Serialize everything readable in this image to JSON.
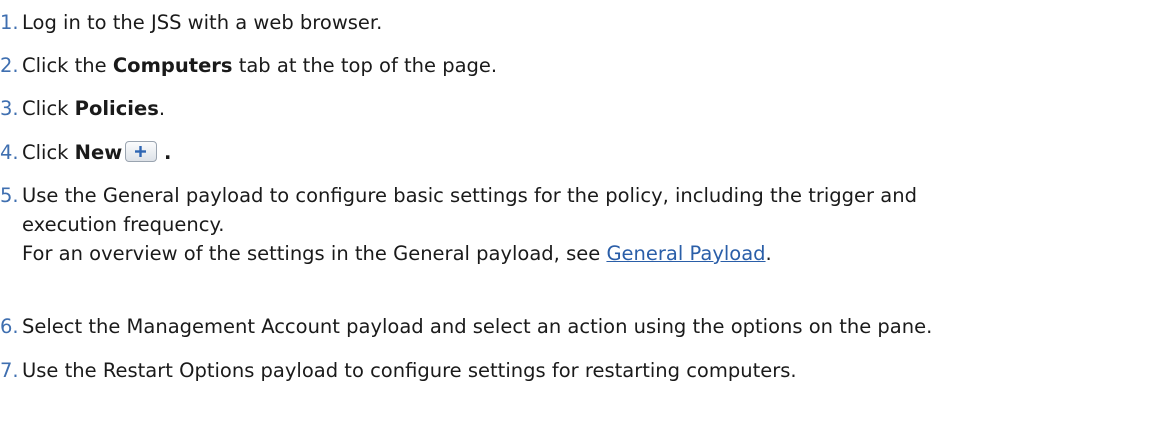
{
  "steps": [
    {
      "num": "1.",
      "text": "Log in to the JSS with a web browser."
    },
    {
      "num": "2.",
      "pre": "Click the ",
      "bold": "Computers",
      "post": " tab at the top of the page."
    },
    {
      "num": "3.",
      "pre": "Click ",
      "bold": "Policies",
      "post": "."
    },
    {
      "num": "4.",
      "pre": "Click ",
      "bold": "New",
      "post": " .",
      "icon": "plus-icon"
    },
    {
      "num": "5.",
      "line1": "Use the General payload to configure basic settings for the policy, including the trigger and",
      "line2": "execution frequency.",
      "line3_pre": "For an overview of the settings in the General payload, see ",
      "link": "General Payload",
      "line3_post": "."
    },
    {
      "num": "6.",
      "text": "Select the Management Account payload and select an action using the options on the pane."
    },
    {
      "num": "7.",
      "text": "Use the Restart Options payload to configure settings for restarting computers."
    }
  ],
  "colors": {
    "number": "#3f6fb0",
    "link": "#2a5ea8",
    "text": "#1a1a1a"
  }
}
